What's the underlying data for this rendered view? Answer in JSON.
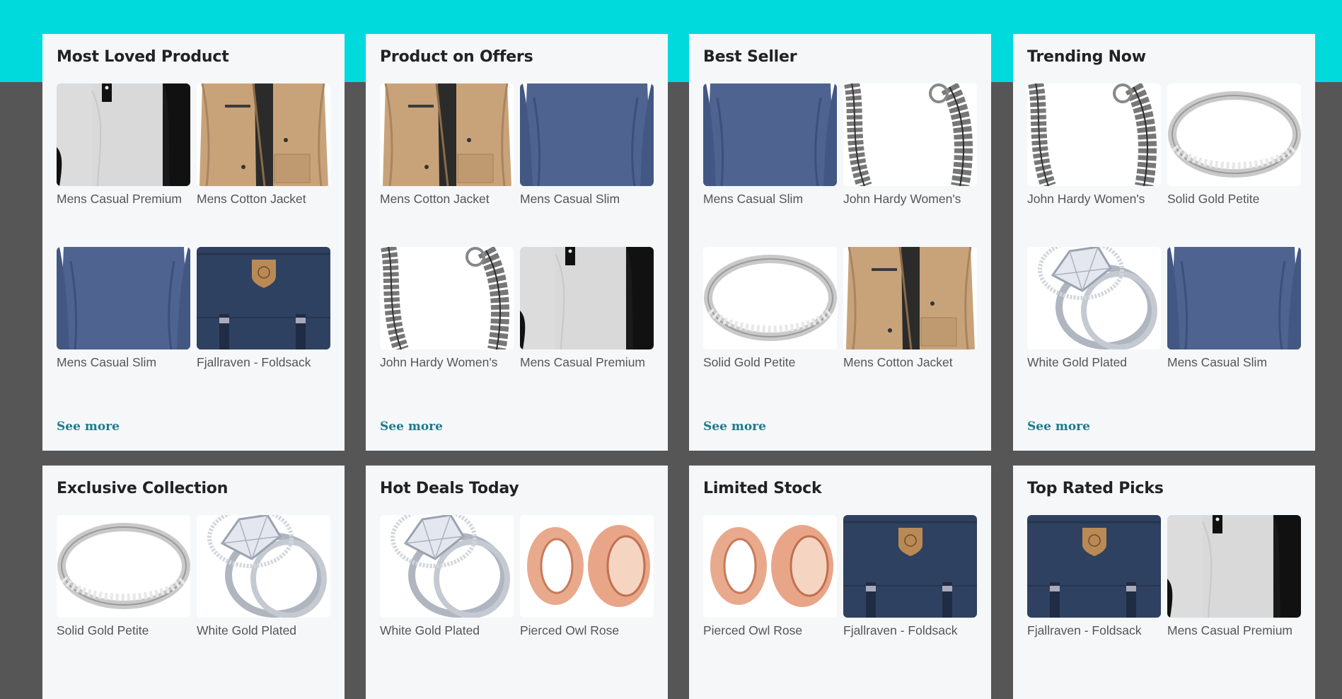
{
  "sections": [
    {
      "title": "Most Loved Product",
      "see_more": "See more",
      "products": [
        {
          "name": "Mens Casual Premium",
          "image": "raglan-tee"
        },
        {
          "name": "Mens Cotton Jacket",
          "image": "cotton-jacket"
        },
        {
          "name": "Mens Casual Slim",
          "image": "slim-tee"
        },
        {
          "name": "Fjallraven - Foldsack",
          "image": "backpack"
        }
      ]
    },
    {
      "title": "Product on Offers",
      "see_more": "See more",
      "products": [
        {
          "name": "Mens Cotton Jacket",
          "image": "cotton-jacket"
        },
        {
          "name": "Mens Casual Slim",
          "image": "slim-tee"
        },
        {
          "name": "John Hardy Women's",
          "image": "dragon-bracelet"
        },
        {
          "name": "Mens Casual Premium",
          "image": "raglan-tee"
        }
      ]
    },
    {
      "title": "Best Seller",
      "see_more": "See more",
      "products": [
        {
          "name": "Mens Casual Slim",
          "image": "slim-tee"
        },
        {
          "name": "John Hardy Women's",
          "image": "dragon-bracelet"
        },
        {
          "name": "Solid Gold Petite",
          "image": "petite-ring"
        },
        {
          "name": "Mens Cotton Jacket",
          "image": "cotton-jacket"
        }
      ]
    },
    {
      "title": "Trending Now",
      "see_more": "See more",
      "products": [
        {
          "name": "John Hardy Women's",
          "image": "dragon-bracelet"
        },
        {
          "name": "Solid Gold Petite",
          "image": "petite-ring"
        },
        {
          "name": "White Gold Plated",
          "image": "halo-ring"
        },
        {
          "name": "Mens Casual Slim",
          "image": "slim-tee"
        }
      ]
    },
    {
      "title": "Exclusive Collection",
      "products": [
        {
          "name": "Solid Gold Petite",
          "image": "petite-ring"
        },
        {
          "name": "White Gold Plated",
          "image": "halo-ring"
        }
      ]
    },
    {
      "title": "Hot Deals Today",
      "products": [
        {
          "name": "White Gold Plated",
          "image": "halo-ring"
        },
        {
          "name": "Pierced Owl Rose",
          "image": "rose-plugs"
        }
      ]
    },
    {
      "title": "Limited Stock",
      "products": [
        {
          "name": "Pierced Owl Rose",
          "image": "rose-plugs"
        },
        {
          "name": "Fjallraven - Foldsack",
          "image": "backpack"
        }
      ]
    },
    {
      "title": "Top Rated Picks",
      "products": [
        {
          "name": "Fjallraven - Foldsack",
          "image": "backpack"
        },
        {
          "name": "Mens Casual Premium",
          "image": "raglan-tee"
        }
      ]
    }
  ],
  "colors": {
    "accent_band": "#00dadc",
    "background": "#565656",
    "card": "#f6f7f9",
    "link": "#1f7a8c"
  }
}
